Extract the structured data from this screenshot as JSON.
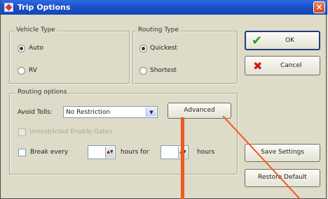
{
  "window": {
    "title": "Trip Options",
    "close_glyph": "×"
  },
  "vehicle_type": {
    "label": "Vehicle Type",
    "options": [
      "Auto",
      "RV"
    ],
    "selected": "Auto"
  },
  "routing_type": {
    "label": "Routing Type",
    "options": [
      "Quickest",
      "Shortest"
    ],
    "selected": "Quickest"
  },
  "routing_options": {
    "label": "Routing options",
    "avoid_tolls_label": "Avoid Tolls:",
    "avoid_tolls_value": "No Restriction",
    "advanced_label": "Advanced",
    "disabled_checkbox_label": "Unrestricted Enable Gates",
    "break_label": "Break every",
    "hours_for_label": "hours for",
    "hours_label": "hours"
  },
  "buttons": {
    "ok": "OK",
    "cancel": "Cancel",
    "save_settings": "Save Settings",
    "restore_default": "Restore Default"
  },
  "icons": {
    "ok": "checkmark-icon",
    "cancel": "x-mark-icon",
    "title": "app-icon"
  },
  "colors": {
    "titlebar": "#1a4fc7",
    "dialog_bg": "#dedbc8",
    "ok_check": "#2f9a2a",
    "cancel_x": "#c8201a",
    "annotation": "#f05a1e"
  }
}
